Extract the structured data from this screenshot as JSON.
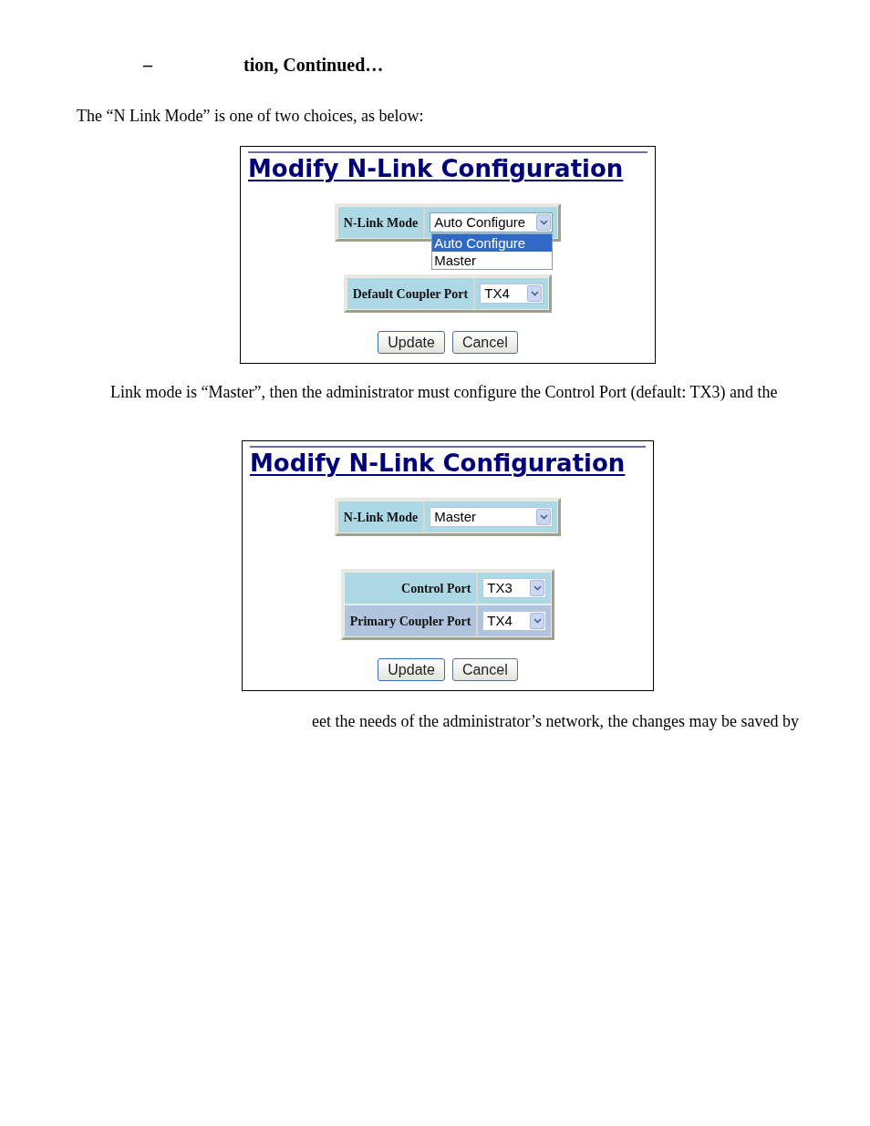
{
  "heading": {
    "dash": "–",
    "text": "tion, Continued…"
  },
  "content": [
    {
      "kind": "paragraph",
      "text": "The “N Link Mode” is one of two choices, as below:"
    },
    {
      "kind": "panel",
      "title": "Modify N-Link Configuration",
      "tables": [
        {
          "rows": [
            {
              "label": "N-Link Mode",
              "select": {
                "value": "Auto Configure",
                "expanded": true,
                "options": [
                  {
                    "label": "Auto Configure",
                    "selected": true
                  },
                  {
                    "label": "Master",
                    "selected": false
                  }
                ]
              }
            }
          ]
        },
        {
          "rows": [
            {
              "label": "Default Coupler Port",
              "select": {
                "value": "TX4",
                "expanded": false
              }
            }
          ]
        }
      ],
      "buttons": [
        "Update",
        "Cancel"
      ]
    },
    {
      "kind": "paragraph",
      "text": "Link mode is “Master”, then the administrator must configure the Control Port (default: TX3) and the"
    },
    {
      "kind": "panel",
      "title": "Modify N-Link Configuration",
      "tables": [
        {
          "rows": [
            {
              "label": "N-Link Mode",
              "select": {
                "value": "Master",
                "expanded": false
              }
            }
          ]
        },
        {
          "rows": [
            {
              "label": "Control Port",
              "select": {
                "value": "TX3",
                "expanded": false
              }
            },
            {
              "label": "Primary Coupler Port",
              "select": {
                "value": "TX4",
                "expanded": false
              }
            }
          ]
        }
      ],
      "buttons": [
        "Update",
        "Cancel"
      ]
    },
    {
      "kind": "paragraph",
      "text": "eet the needs of the administrator’s network, the changes may be saved by"
    }
  ]
}
